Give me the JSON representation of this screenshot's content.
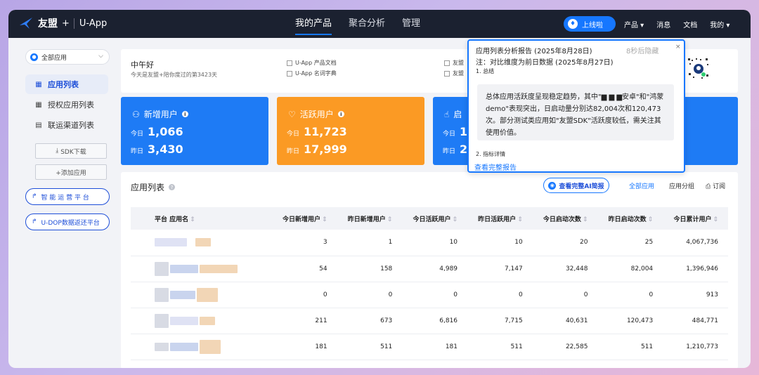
{
  "nav": {
    "logo_text": "友盟",
    "logo_plus": "+",
    "app_name": "U-App",
    "tabs": [
      {
        "label": "我的产品",
        "active": true
      },
      {
        "label": "聚合分析",
        "active": false
      },
      {
        "label": "管理",
        "active": false
      }
    ],
    "online_label": "上线啦",
    "right": {
      "product": "产品 ▾",
      "message": "消息",
      "docs": "文档",
      "mine": "我的 ▾"
    }
  },
  "sidebar": {
    "app_select": "全部应用",
    "items": [
      {
        "label": "应用列表",
        "icon": "grid-icon",
        "active": true
      },
      {
        "label": "授权应用列表",
        "icon": "grid-icon",
        "active": false
      },
      {
        "label": "联运渠道列表",
        "icon": "list-icon",
        "active": false
      }
    ],
    "sdk_download": "SDK下载",
    "add_app": "+添加应用",
    "links": [
      "智 能 运 营 平 台",
      "U-DOP数据返还平台"
    ]
  },
  "greeting": {
    "title": "中午好",
    "subtitle": "今天是友盟+陪你度过的第3423天",
    "docs": [
      "U-App 产品文档",
      "U-App 名词字典",
      "友盟",
      "友盟"
    ]
  },
  "stats": [
    {
      "title": "新增用户",
      "today_label": "今日",
      "today": "1,066",
      "yesterday_label": "昨日",
      "yesterday": "3,430",
      "color": "#1e7bf5"
    },
    {
      "title": "活跃用户",
      "today_label": "今日",
      "today": "11,723",
      "yesterday_label": "昨日",
      "yesterday": "17,999",
      "color": "#fb9a24"
    },
    {
      "title": "启",
      "today_label": "今日",
      "today": "1",
      "yesterday_label": "昨日",
      "yesterday": "2",
      "color": "#1e7bf5"
    }
  ],
  "app_list": {
    "title": "应用列表",
    "ai_button": "查看完整AI简报",
    "segments": [
      "全部应用",
      "应用分组",
      "订阅"
    ],
    "columns": [
      "平台  应用名",
      "今日新增用户",
      "昨日新增用户",
      "今日活跃用户",
      "昨日活跃用户",
      "今日启动次数",
      "昨日启动次数",
      "今日累计用户"
    ],
    "rows": [
      [
        "3",
        "1",
        "10",
        "10",
        "20",
        "25",
        "4,067,736"
      ],
      [
        "54",
        "158",
        "4,989",
        "7,147",
        "32,448",
        "82,004",
        "1,396,946"
      ],
      [
        "0",
        "0",
        "0",
        "0",
        "0",
        "0",
        "913"
      ],
      [
        "211",
        "673",
        "6,816",
        "7,715",
        "40,631",
        "120,473",
        "484,771"
      ],
      [
        "181",
        "511",
        "181",
        "511",
        "22,585",
        "511",
        "1,210,773"
      ]
    ]
  },
  "popup": {
    "title": "应用列表分析报告 (2025年8月28日)",
    "timer": "8秒后隐藏",
    "close": "×",
    "note": "注：对比维度为前日数据 (2025年8月27日)",
    "section": "1. 总结",
    "summary": "总体应用活跃度呈现稳定趋势，其中\"▆ ▆ ▆安卓\"和\"鸿蒙demo\"表现突出，日启动量分别达82,004次和120,473次。部分测试类应用如\"友盟SDK\"活跃度较低，需关注其使用价值。",
    "detail": "2. 指标详情",
    "full_report": "查看完整报告"
  },
  "colors": {
    "accent": "#1677ff",
    "nav_bg": "#1b2130",
    "orange": "#fb9a24"
  }
}
